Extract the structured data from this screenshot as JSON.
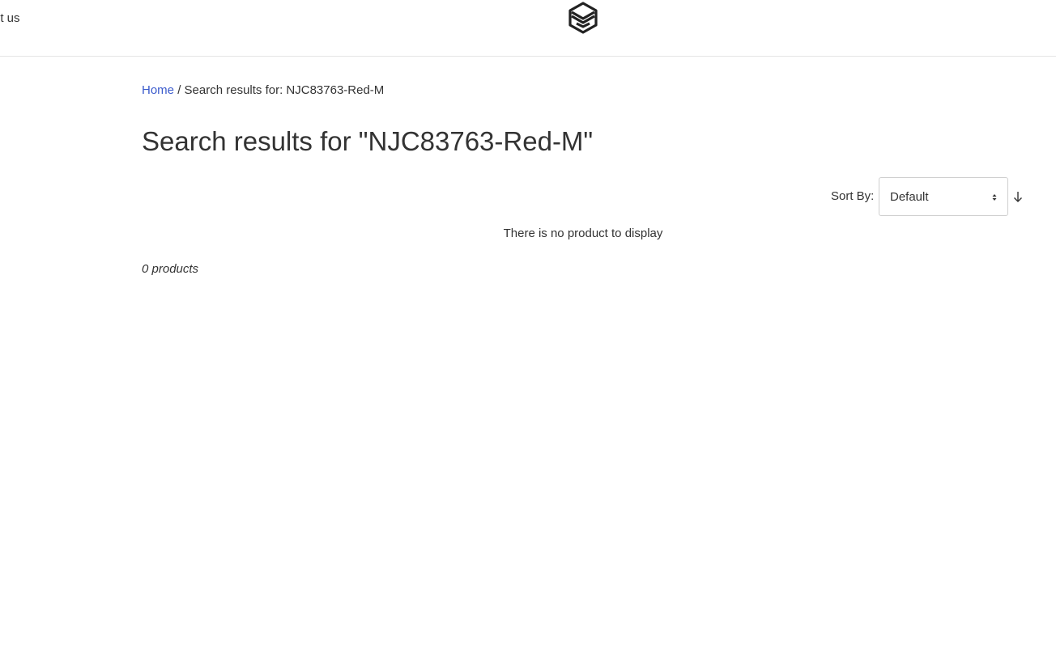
{
  "header": {
    "nav_about": "ut us",
    "logo_icon": "layered-stack-logo-icon"
  },
  "breadcrumb": {
    "home": "Home",
    "separator": "/",
    "current": "Search results for: NJC83763-Red-M"
  },
  "page": {
    "title": "Search results for \"NJC83763-Red-M\""
  },
  "sort": {
    "label": "Sort By:",
    "selected": "Default",
    "direction_icon": "arrow-down-icon"
  },
  "results": {
    "empty_message": "There is no product to display",
    "count": "0 products"
  },
  "colors": {
    "link": "#3b5bcc",
    "text": "#333333",
    "border": "#cfcfcf"
  }
}
